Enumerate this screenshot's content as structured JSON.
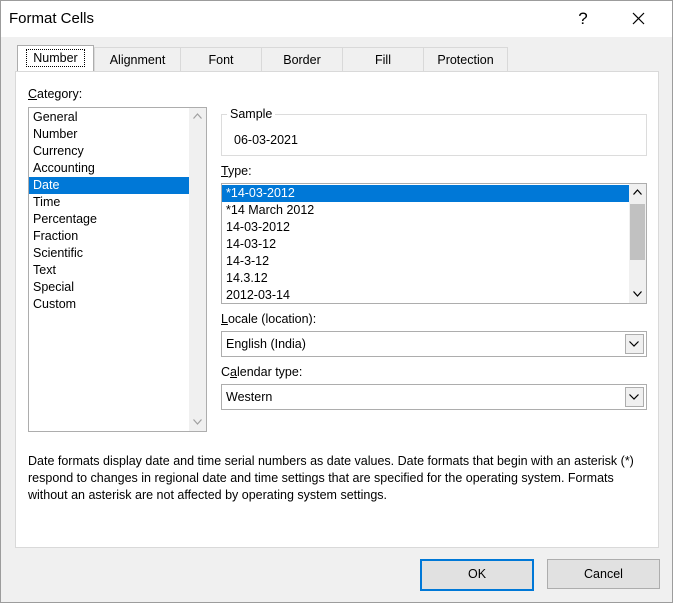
{
  "window": {
    "title": "Format Cells",
    "help_label": "?"
  },
  "tabs": [
    {
      "label": "Number",
      "active": true
    },
    {
      "label": "Alignment",
      "active": false
    },
    {
      "label": "Font",
      "active": false
    },
    {
      "label": "Border",
      "active": false
    },
    {
      "label": "Fill",
      "active": false
    },
    {
      "label": "Protection",
      "active": false
    }
  ],
  "category": {
    "label_hotkey": "C",
    "label_rest": "ategory:",
    "items": [
      "General",
      "Number",
      "Currency",
      "Accounting",
      "Date",
      "Time",
      "Percentage",
      "Fraction",
      "Scientific",
      "Text",
      "Special",
      "Custom"
    ],
    "selected": "Date"
  },
  "sample": {
    "label": "Sample",
    "value": "06-03-2021"
  },
  "type": {
    "label_hotkey": "T",
    "label_rest": "ype:",
    "items": [
      "*14-03-2012",
      "*14 March 2012",
      "14-03-2012",
      "14-03-12",
      "14-3-12",
      "14.3.12",
      "2012-03-14"
    ],
    "selected": "*14-03-2012"
  },
  "locale": {
    "label_hotkey": "L",
    "label_rest": "ocale (location):",
    "value": "English (India)"
  },
  "calendar": {
    "label_pre": "C",
    "label_hotkey": "a",
    "label_rest": "lendar type:",
    "value": "Western"
  },
  "description": "Date formats display date and time serial numbers as date values.  Date formats that begin with an asterisk (*) respond to changes in regional date and time settings that are specified for the operating system. Formats without an asterisk are not affected by operating system settings.",
  "buttons": {
    "ok": "OK",
    "cancel": "Cancel"
  },
  "colors": {
    "selection": "#0078d7",
    "default_button_border": "#0078d7"
  },
  "icons": {
    "close": "close-icon",
    "scroll_up": "chevron-up-icon",
    "scroll_down": "chevron-down-icon",
    "dropdown": "chevron-down-icon"
  }
}
